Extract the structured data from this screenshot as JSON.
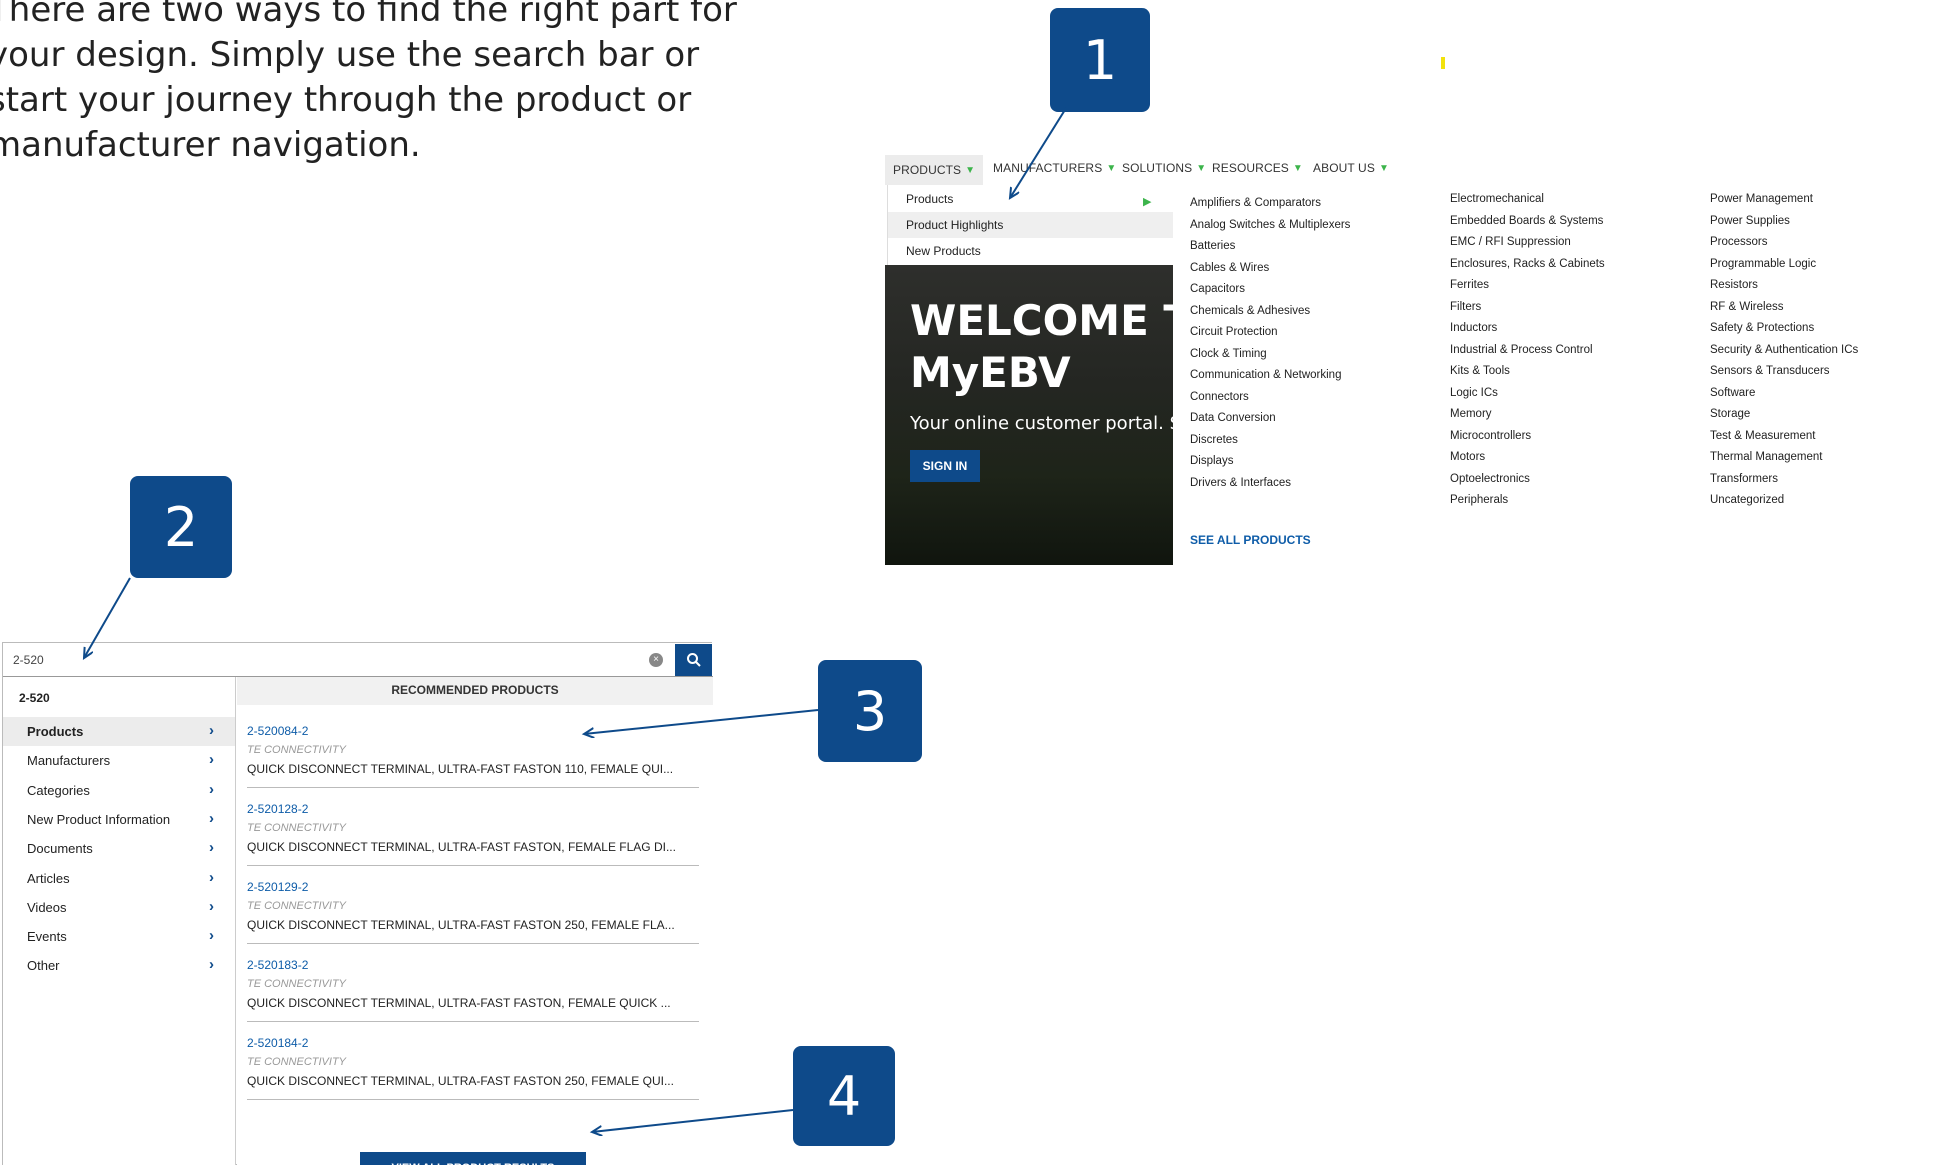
{
  "intro": {
    "lines": [
      "There are two ways to find the right part for",
      "your design. Simply use the search bar or",
      "start your journey through the product or",
      "manufacturer navigation."
    ]
  },
  "badges": [
    "1",
    "2",
    "3",
    "4"
  ],
  "colors": {
    "brand_blue": "#0e4a8a",
    "accent_green": "#3cb44b",
    "link_blue": "#0e5ca8"
  },
  "nav": {
    "items": [
      "PRODUCTS",
      "MANUFACTURERS",
      "SOLUTIONS",
      "RESOURCES",
      "ABOUT US"
    ],
    "products_menu": [
      "Products",
      "Product Highlights",
      "New Products"
    ]
  },
  "hero": {
    "title_line1": "WELCOME TO",
    "title_line2": "MyEBV",
    "subtitle": "Your online customer portal. S",
    "sign_in": "SIGN IN"
  },
  "mega_menu": {
    "col1": [
      "Amplifiers & Comparators",
      "Analog Switches & Multiplexers",
      "Batteries",
      "Cables & Wires",
      "Capacitors",
      "Chemicals & Adhesives",
      "Circuit Protection",
      "Clock & Timing",
      "Communication & Networking",
      "Connectors",
      "Data Conversion",
      "Discretes",
      "Displays",
      "Drivers & Interfaces"
    ],
    "col2": [
      "Electromechanical",
      "Embedded Boards & Systems",
      "EMC / RFI Suppression",
      "Enclosures, Racks & Cabinets",
      "Ferrites",
      "Filters",
      "Inductors",
      "Industrial & Process Control",
      "Kits & Tools",
      "Logic ICs",
      "Memory",
      "Microcontrollers",
      "Motors",
      "Optoelectronics",
      "Peripherals"
    ],
    "col3": [
      "Power Management",
      "Power Supplies",
      "Processors",
      "Programmable Logic",
      "Resistors",
      "RF & Wireless",
      "Safety & Protections",
      "Security & Authentication ICs",
      "Sensors & Transducers",
      "Software",
      "Storage",
      "Test & Measurement",
      "Thermal Management",
      "Transformers",
      "Uncategorized"
    ],
    "see_all": "SEE ALL PRODUCTS"
  },
  "search": {
    "value": "2-520",
    "query_label": "2-520",
    "categories": [
      "Products",
      "Manufacturers",
      "Categories",
      "New Product Information",
      "Documents",
      "Articles",
      "Videos",
      "Events",
      "Other"
    ],
    "recommended_header": "RECOMMENDED PRODUCTS",
    "products": [
      {
        "pn": "2-520084-2",
        "mfr": "TE CONNECTIVITY",
        "desc": "QUICK DISCONNECT TERMINAL, ULTRA-FAST FASTON 110, FEMALE QUI..."
      },
      {
        "pn": "2-520128-2",
        "mfr": "TE CONNECTIVITY",
        "desc": "QUICK DISCONNECT TERMINAL, ULTRA-FAST FASTON, FEMALE FLAG DI..."
      },
      {
        "pn": "2-520129-2",
        "mfr": "TE CONNECTIVITY",
        "desc": "QUICK DISCONNECT TERMINAL, ULTRA-FAST FASTON 250, FEMALE FLA..."
      },
      {
        "pn": "2-520183-2",
        "mfr": "TE CONNECTIVITY",
        "desc": "QUICK DISCONNECT TERMINAL, ULTRA-FAST FASTON, FEMALE QUICK ..."
      },
      {
        "pn": "2-520184-2",
        "mfr": "TE CONNECTIVITY",
        "desc": "QUICK DISCONNECT TERMINAL, ULTRA-FAST FASTON 250, FEMALE QUI..."
      }
    ],
    "view_all": "VIEW ALL PRODUCT RESULTS"
  }
}
